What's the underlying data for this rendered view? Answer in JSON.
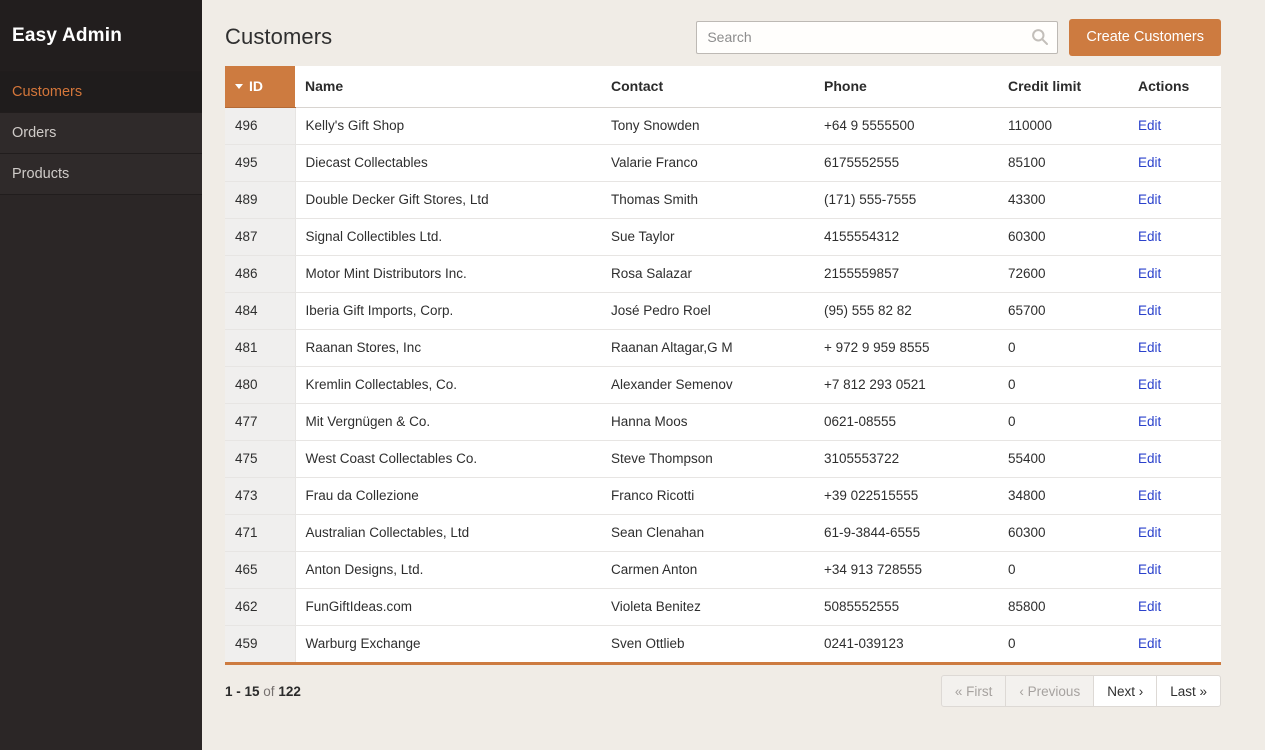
{
  "sidebar": {
    "brand": "Easy Admin",
    "items": [
      {
        "label": "Customers",
        "active": true
      },
      {
        "label": "Orders",
        "active": false
      },
      {
        "label": "Products",
        "active": false
      }
    ]
  },
  "header": {
    "title": "Customers",
    "search": {
      "value": "",
      "placeholder": "Search",
      "icon": "search-icon"
    },
    "create_button": "Create Customers"
  },
  "table": {
    "sort_column": "ID",
    "sort_direction": "desc",
    "columns": [
      {
        "label": "ID",
        "key": "id"
      },
      {
        "label": "Name",
        "key": "name"
      },
      {
        "label": "Contact",
        "key": "contact"
      },
      {
        "label": "Phone",
        "key": "phone"
      },
      {
        "label": "Credit limit",
        "key": "credit"
      },
      {
        "label": "Actions",
        "key": "actions"
      }
    ],
    "action_label": "Edit",
    "rows": [
      {
        "id": "496",
        "name": "Kelly's Gift Shop",
        "contact": "Tony Snowden",
        "phone": "+64 9 5555500",
        "credit": "110000",
        "action": "Edit"
      },
      {
        "id": "495",
        "name": "Diecast Collectables",
        "contact": "Valarie Franco",
        "phone": "6175552555",
        "credit": "85100",
        "action": "Edit"
      },
      {
        "id": "489",
        "name": "Double Decker Gift Stores, Ltd",
        "contact": "Thomas Smith",
        "phone": "(171) 555-7555",
        "credit": "43300",
        "action": "Edit"
      },
      {
        "id": "487",
        "name": "Signal Collectibles Ltd.",
        "contact": "Sue Taylor",
        "phone": "4155554312",
        "credit": "60300",
        "action": "Edit"
      },
      {
        "id": "486",
        "name": "Motor Mint Distributors Inc.",
        "contact": "Rosa Salazar",
        "phone": "2155559857",
        "credit": "72600",
        "action": "Edit"
      },
      {
        "id": "484",
        "name": "Iberia Gift Imports, Corp.",
        "contact": "José Pedro Roel",
        "phone": "(95) 555 82 82",
        "credit": "65700",
        "action": "Edit"
      },
      {
        "id": "481",
        "name": "Raanan Stores, Inc",
        "contact": "Raanan Altagar,G M",
        "phone": "+ 972 9 959 8555",
        "credit": "0",
        "action": "Edit"
      },
      {
        "id": "480",
        "name": "Kremlin Collectables, Co.",
        "contact": "Alexander Semenov",
        "phone": "+7 812 293 0521",
        "credit": "0",
        "action": "Edit"
      },
      {
        "id": "477",
        "name": "Mit Vergnügen & Co.",
        "contact": "Hanna Moos",
        "phone": "0621-08555",
        "credit": "0",
        "action": "Edit"
      },
      {
        "id": "475",
        "name": "West Coast Collectables Co.",
        "contact": "Steve Thompson",
        "phone": "3105553722",
        "credit": "55400",
        "action": "Edit"
      },
      {
        "id": "473",
        "name": "Frau da Collezione",
        "contact": "Franco Ricotti",
        "phone": "+39 022515555",
        "credit": "34800",
        "action": "Edit"
      },
      {
        "id": "471",
        "name": "Australian Collectables, Ltd",
        "contact": "Sean Clenahan",
        "phone": "61-9-3844-6555",
        "credit": "60300",
        "action": "Edit"
      },
      {
        "id": "465",
        "name": "Anton Designs, Ltd.",
        "contact": "Carmen Anton",
        "phone": "+34 913 728555",
        "credit": "0",
        "action": "Edit"
      },
      {
        "id": "462",
        "name": "FunGiftIdeas.com",
        "contact": "Violeta Benitez",
        "phone": "5085552555",
        "credit": "85800",
        "action": "Edit"
      },
      {
        "id": "459",
        "name": "Warburg Exchange",
        "contact": "Sven Ottlieb",
        "phone": "0241-039123",
        "credit": "0",
        "action": "Edit"
      }
    ]
  },
  "footer": {
    "range": "1 - 15",
    "of_word": "of",
    "total": "122",
    "pager": [
      {
        "label": "« First",
        "disabled": true
      },
      {
        "label": "‹ Previous",
        "disabled": true
      },
      {
        "label": "Next ›",
        "disabled": false
      },
      {
        "label": "Last »",
        "disabled": false
      }
    ]
  },
  "colors": {
    "accent": "#cd7b40",
    "sidebar_bg": "#2b2626",
    "page_bg": "#f0ece6",
    "link": "#2b42cc"
  }
}
